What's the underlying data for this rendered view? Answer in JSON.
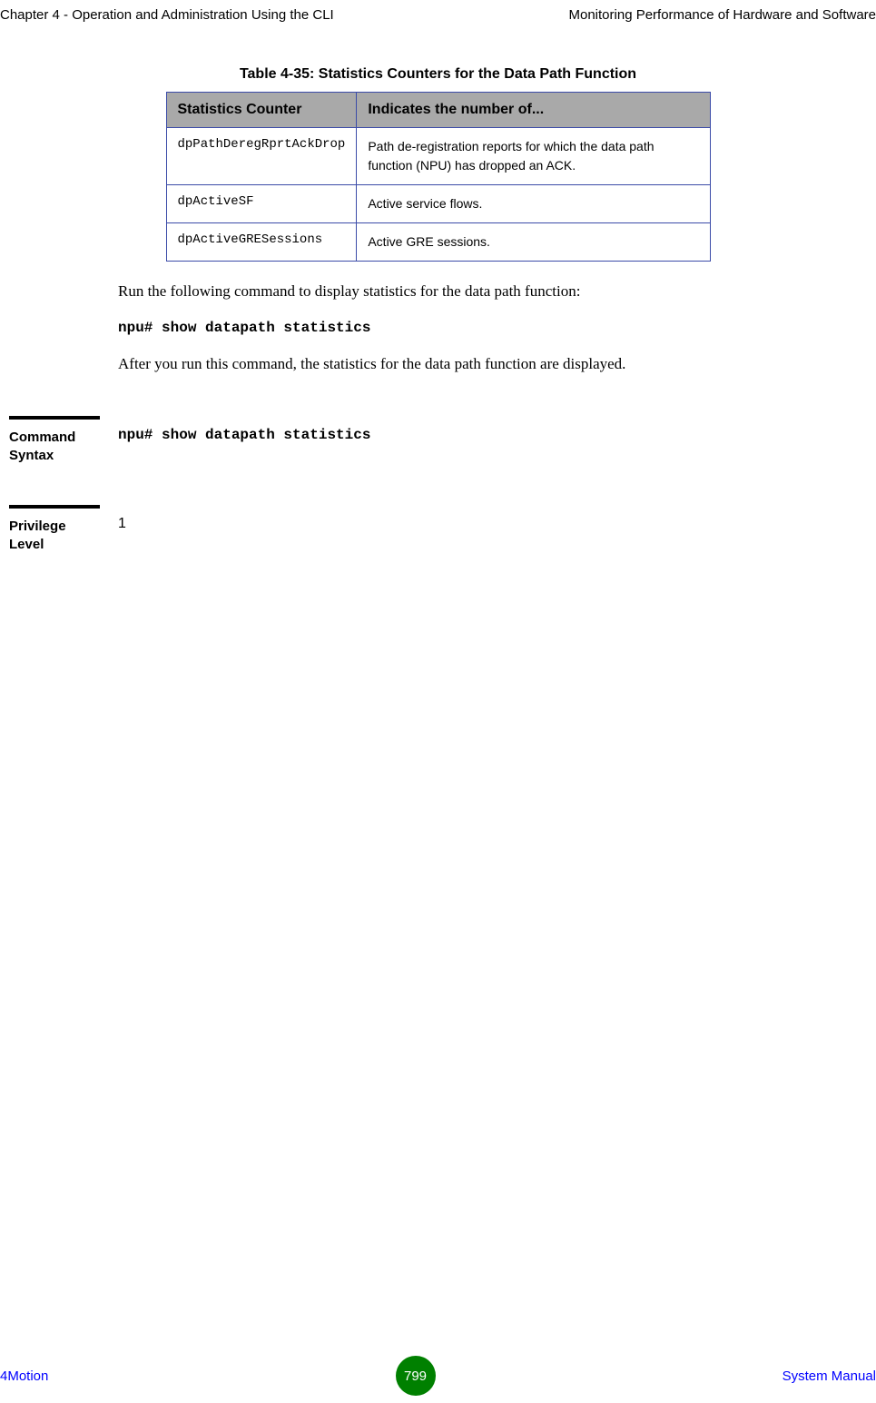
{
  "header": {
    "left": "Chapter 4 - Operation and Administration Using the CLI",
    "right": "Monitoring Performance of Hardware and Software"
  },
  "table": {
    "caption": "Table 4-35: Statistics Counters for the Data Path Function",
    "col1_header": "Statistics Counter",
    "col2_header": "Indicates the number of...",
    "rows": [
      {
        "counter": "dpPathDeregRprtAckDrop",
        "desc": "Path de-registration reports for which the data path function (NPU) has dropped an ACK."
      },
      {
        "counter": "dpActiveSF",
        "desc": "Active service flows."
      },
      {
        "counter": "dpActiveGRESessions",
        "desc": "Active GRE sessions."
      }
    ]
  },
  "body": {
    "para1": "Run the following command to display statistics for the data path function:",
    "command": "npu# show datapath statistics",
    "para2": "After you run this command, the statistics for the data path function are displayed."
  },
  "sections": {
    "command_syntax_label1": "Command",
    "command_syntax_label2": "Syntax",
    "command_syntax_value": "npu# show datapath statistics",
    "privilege_label1": "Privilege",
    "privilege_label2": "Level",
    "privilege_value": "1"
  },
  "footer": {
    "left": "4Motion",
    "page": "799",
    "right": "System Manual"
  }
}
